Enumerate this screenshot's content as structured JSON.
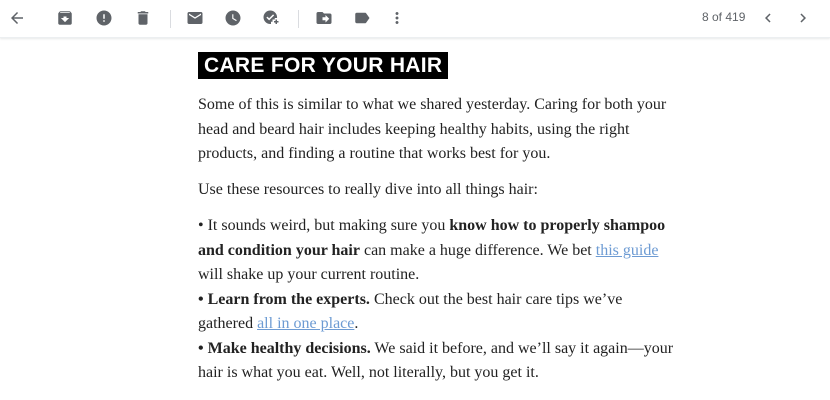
{
  "toolbar": {
    "icons": [
      "back-arrow-icon",
      "archive-icon",
      "report-spam-icon",
      "delete-icon",
      "mark-unread-icon",
      "snooze-icon",
      "add-to-tasks-icon",
      "move-to-icon",
      "labels-icon",
      "more-options-icon",
      "newer-chevron-icon",
      "older-chevron-icon"
    ],
    "counter": "8 of 419"
  },
  "email": {
    "heading": "CARE FOR YOUR HAIR",
    "intro": "Some of this is similar to what we shared yesterday. Caring for both your head and beard hair includes keeping healthy habits, using the right products, and finding a routine that works best for you.",
    "resources_intro": "Use these resources to really dive into all things hair:",
    "bullet1": {
      "prefix": "• It sounds weird, but making sure you ",
      "bold": "know how to properly shampoo and condition your hair",
      "middle": " can make a huge difference. We bet ",
      "link": "this guide",
      "suffix": " will shake up your current routine."
    },
    "bullet2": {
      "bold": "• Learn from the experts.",
      "middle": " Check out the best hair care tips we’ve gathered ",
      "link": "all in one place",
      "suffix": "."
    },
    "bullet3": {
      "bold": "• Make healthy decisions.",
      "text": " We said it before, and we’ll say it again—your hair is what you eat. Well, not literally, but you get it."
    }
  }
}
